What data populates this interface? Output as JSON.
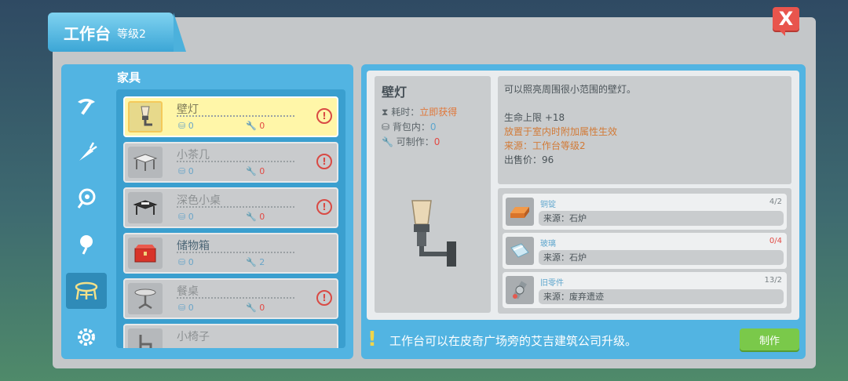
{
  "window": {
    "title": "工作台",
    "level": "等级2",
    "close_label": "X"
  },
  "categories": [
    {
      "icon": "pickaxe-icon"
    },
    {
      "icon": "carrot-icon"
    },
    {
      "icon": "seed-icon"
    },
    {
      "icon": "flower-icon"
    },
    {
      "icon": "furniture-icon",
      "active": true
    },
    {
      "icon": "gear-icon"
    }
  ],
  "list": {
    "title": "家具",
    "items": [
      {
        "name": "壁灯",
        "bag": "0",
        "craftable": "0",
        "warning": "!"
      },
      {
        "name": "小茶几",
        "bag": "0",
        "craftable": "0",
        "warning": "!"
      },
      {
        "name": "深色小桌",
        "bag": "0",
        "craftable": "0",
        "warning": "!"
      },
      {
        "name": "储物箱",
        "bag": "0",
        "craftable": "2"
      },
      {
        "name": "餐桌",
        "bag": "0",
        "craftable": "0",
        "warning": "!"
      },
      {
        "name": "小椅子"
      }
    ]
  },
  "detail": {
    "name": "壁灯",
    "time_label": "耗时：",
    "time_value": "立即获得",
    "bag_label": "背包内：",
    "bag_value": "0",
    "craft_label": "可制作：",
    "craft_value": "0",
    "description": "可以照亮周围很小范围的壁灯。",
    "hp": "生命上限 +18",
    "effect": "放置于室内时附加属性生效",
    "source": "来源：工作台等级2",
    "price": "出售价：96"
  },
  "materials": [
    {
      "name": "铜锭",
      "count": "4/2",
      "source": "来源：石炉",
      "icon": "copper-ingot-icon",
      "count_color": "#7a8286"
    },
    {
      "name": "玻璃",
      "count": "0/4",
      "source": "来源：石炉",
      "icon": "glass-icon",
      "count_color": "#e24a44"
    },
    {
      "name": "旧零件",
      "count": "13/2",
      "source": "来源：废弃遗迹",
      "icon": "old-parts-icon",
      "count_color": "#7a8286"
    }
  ],
  "footer": {
    "hint_icon": "!",
    "hint": "工作台可以在皮奇广场旁的艾吉建筑公司升级。",
    "make_label": "制作"
  }
}
